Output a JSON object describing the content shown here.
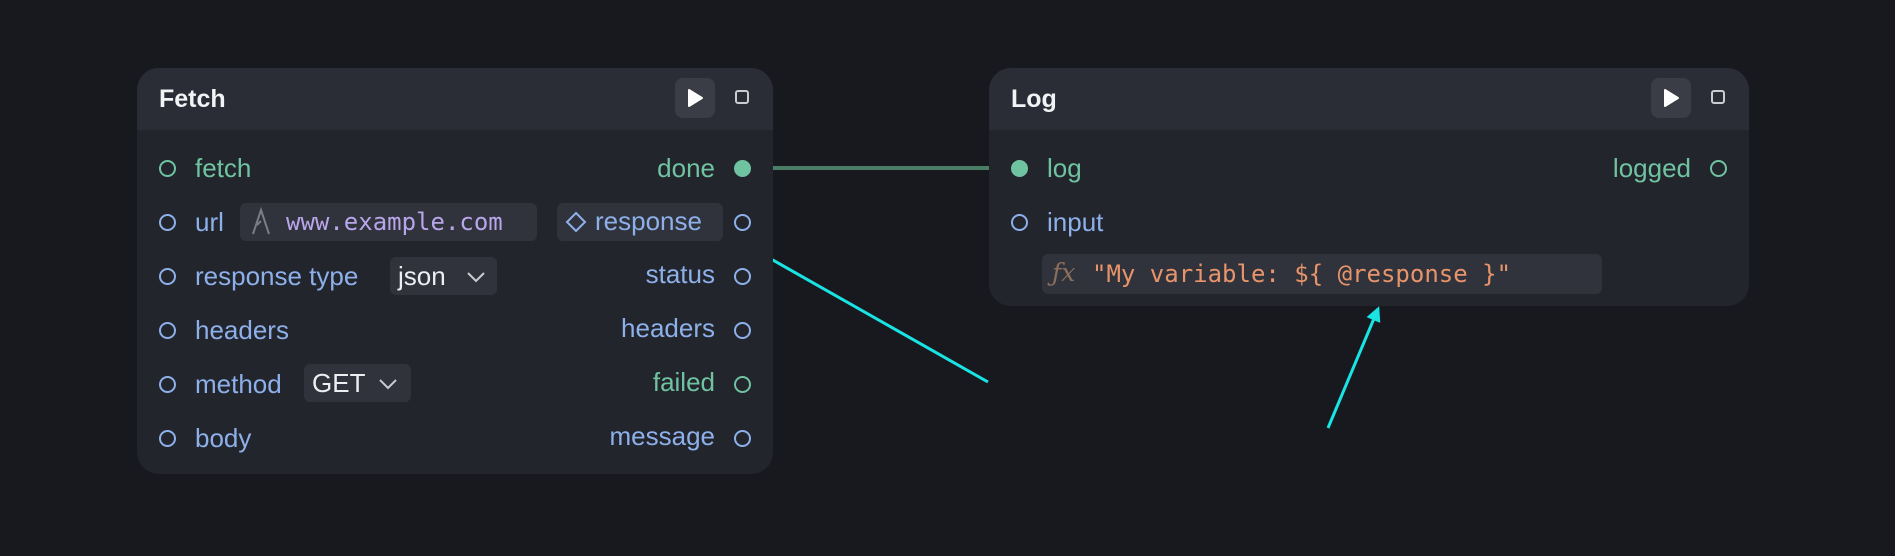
{
  "fetch_node": {
    "title": "Fetch",
    "inputs": {
      "fetch": "fetch",
      "url": "url",
      "url_value": "www.example.com",
      "response_type": "response type",
      "response_type_value": "json",
      "headers": "headers",
      "method": "method",
      "method_value": "GET",
      "body": "body"
    },
    "outputs": {
      "done": "done",
      "response": "response",
      "status": "status",
      "headers": "headers",
      "failed": "failed",
      "message": "message"
    }
  },
  "log_node": {
    "title": "Log",
    "inputs": {
      "log": "log",
      "input": "input",
      "expression": "\"My variable: ${ @response }\""
    },
    "outputs": {
      "logged": "logged"
    }
  },
  "icons": {
    "run": "play-icon",
    "stop": "stop-icon",
    "string": "string-type-icon",
    "object": "diamond-icon",
    "function": "fx-icon",
    "dropdown": "chevron-down-icon"
  },
  "colors": {
    "background": "#17191e",
    "node": "#22252c",
    "node_header": "#2a2d35",
    "exec_port": "#6fc3a0",
    "data_port": "#8eb0ea",
    "string_value": "#b9a6ea",
    "expression": "#e8946b",
    "annotation_arrow": "#19e3e3",
    "connection": "#4a7c66"
  }
}
